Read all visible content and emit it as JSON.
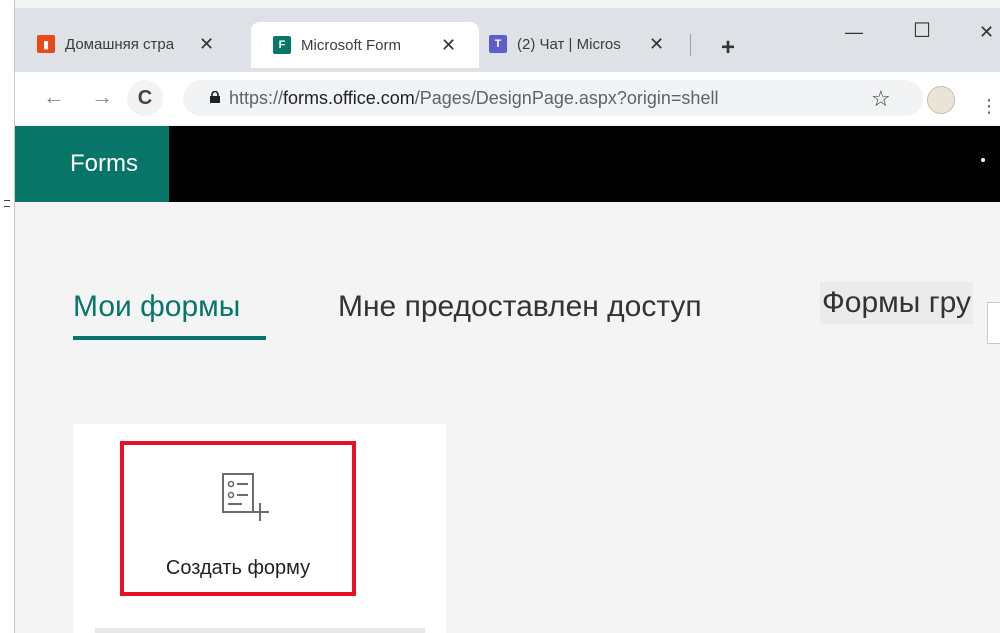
{
  "browser": {
    "tabs": [
      {
        "label": "Домашняя стра",
        "icon": "office-icon",
        "close": "✕"
      },
      {
        "label": "Microsoft Form",
        "icon": "forms-icon",
        "close": "✕"
      },
      {
        "label": "(2) Чат | Micros",
        "icon": "teams-icon",
        "close": "✕"
      }
    ],
    "new_tab": "+",
    "window_controls": {
      "minimize": "—",
      "maximize": "☐",
      "close": "✕"
    },
    "url": {
      "scheme": "https://",
      "host": "forms.office.com",
      "path": "/Pages/DesignPage.aspx?origin=shell"
    },
    "nav": {
      "back": "←",
      "forward": "→",
      "reload": "C"
    },
    "star": "☆"
  },
  "app": {
    "brand": "Forms",
    "accent_color": "#077568"
  },
  "nav_tabs": [
    {
      "label": "Мои формы",
      "active": true
    },
    {
      "label": "Мне предоставлен доступ",
      "active": false
    },
    {
      "label": "Формы гру",
      "active": false
    }
  ],
  "create_card": {
    "label": "Создать форму",
    "icon": "new-form-icon",
    "highlight_color": "#e81123"
  }
}
